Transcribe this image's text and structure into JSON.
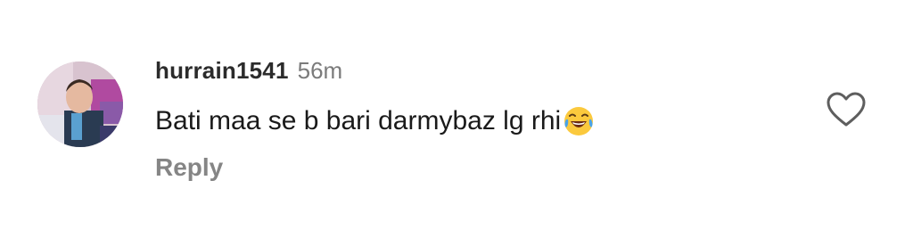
{
  "comment": {
    "username": "hurrain1541",
    "timestamp": "56m",
    "text": "Bati maa se b bari darmybaz lg rhi",
    "emoji": "face-with-tears-of-joy",
    "reply_label": "Reply"
  },
  "icons": {
    "like": "heart-outline-icon"
  },
  "colors": {
    "username": "#2b2b2b",
    "timestamp": "#7b7b7b",
    "text": "#1a1a1a",
    "reply": "#858585",
    "heart_stroke": "#5e5e5e"
  }
}
